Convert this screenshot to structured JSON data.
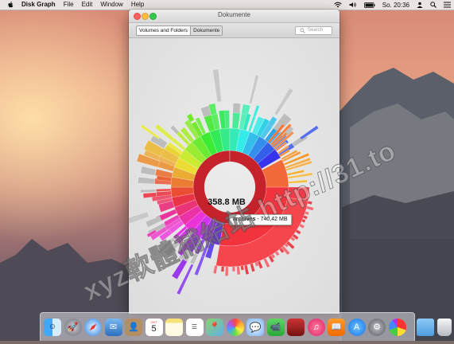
{
  "menubar": {
    "app_name": "Disk Graph",
    "items": [
      "File",
      "Edit",
      "Window",
      "Help"
    ],
    "clock": "So. 20:36",
    "icons": [
      "apple-icon",
      "wifi-icon",
      "volume-icon",
      "battery-icon",
      "user-icon",
      "spotlight-icon",
      "list-icon"
    ]
  },
  "window": {
    "title": "Dokumente",
    "breadcrumb": [
      "Volumes and Folders",
      "Dokumente"
    ],
    "search_placeholder": "Search"
  },
  "graph": {
    "center_size": "358.8 MB",
    "tooltip_name": "archives",
    "tooltip_size": " - 740,42 MB"
  },
  "dock": {
    "calendar_day": "5",
    "calendar_month": "OKT",
    "apps": [
      "finder",
      "launchpad",
      "safari",
      "mail",
      "contacts",
      "calendar",
      "notes",
      "reminders",
      "maps",
      "photos",
      "messages",
      "facetime",
      "photo-booth",
      "itunes",
      "ibooks",
      "app-store",
      "system-preferences",
      "disk-graph",
      "downloads",
      "trash"
    ]
  },
  "watermark": "xyz軟體補給站 http://31.to",
  "colors": {
    "menubar": "#ececec",
    "window_bg": "#e9e9e9",
    "ring_red": "#c8202a",
    "accent_red": "#f0202e"
  }
}
